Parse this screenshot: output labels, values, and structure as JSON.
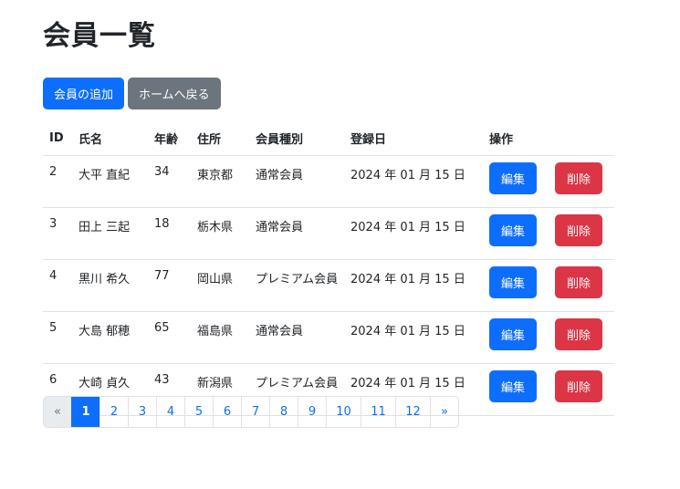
{
  "page": {
    "title": "会員一覧"
  },
  "actions": {
    "add_label": "会員の追加",
    "home_label": "ホームへ戻る"
  },
  "table": {
    "headers": [
      "ID",
      "氏名",
      "年齢",
      "住所",
      "会員種別",
      "登録日",
      "操作"
    ],
    "rows": [
      {
        "id": "2",
        "name": "大平 直紀",
        "age": "34",
        "address": "東京都",
        "type": "通常会員",
        "date": "2024 年 01 月 15 日",
        "edit": "編集",
        "delete": "削除"
      },
      {
        "id": "3",
        "name": "田上 三起",
        "age": "18",
        "address": "栃木県",
        "type": "通常会員",
        "date": "2024 年 01 月 15 日",
        "edit": "編集",
        "delete": "削除"
      },
      {
        "id": "4",
        "name": "黒川 希久",
        "age": "77",
        "address": "岡山県",
        "type": "プレミアム会員",
        "date": "2024 年 01 月 15 日",
        "edit": "編集",
        "delete": "削除"
      },
      {
        "id": "5",
        "name": "大島 郁穂",
        "age": "65",
        "address": "福島県",
        "type": "通常会員",
        "date": "2024 年 01 月 15 日",
        "edit": "編集",
        "delete": "削除"
      },
      {
        "id": "6",
        "name": "大崎 貞久",
        "age": "43",
        "address": "新潟県",
        "type": "プレミアム会員",
        "date": "2024 年 01 月 15 日",
        "edit": "編集",
        "delete": "削除"
      }
    ]
  },
  "pagination": {
    "prev": "«",
    "next": "»",
    "pages": [
      "1",
      "2",
      "3",
      "4",
      "5",
      "6",
      "7",
      "8",
      "9",
      "10",
      "11",
      "12"
    ],
    "current": "1"
  },
  "colors": {
    "primary": "#0d6efd",
    "secondary": "#6c757d",
    "danger": "#dc3545"
  }
}
